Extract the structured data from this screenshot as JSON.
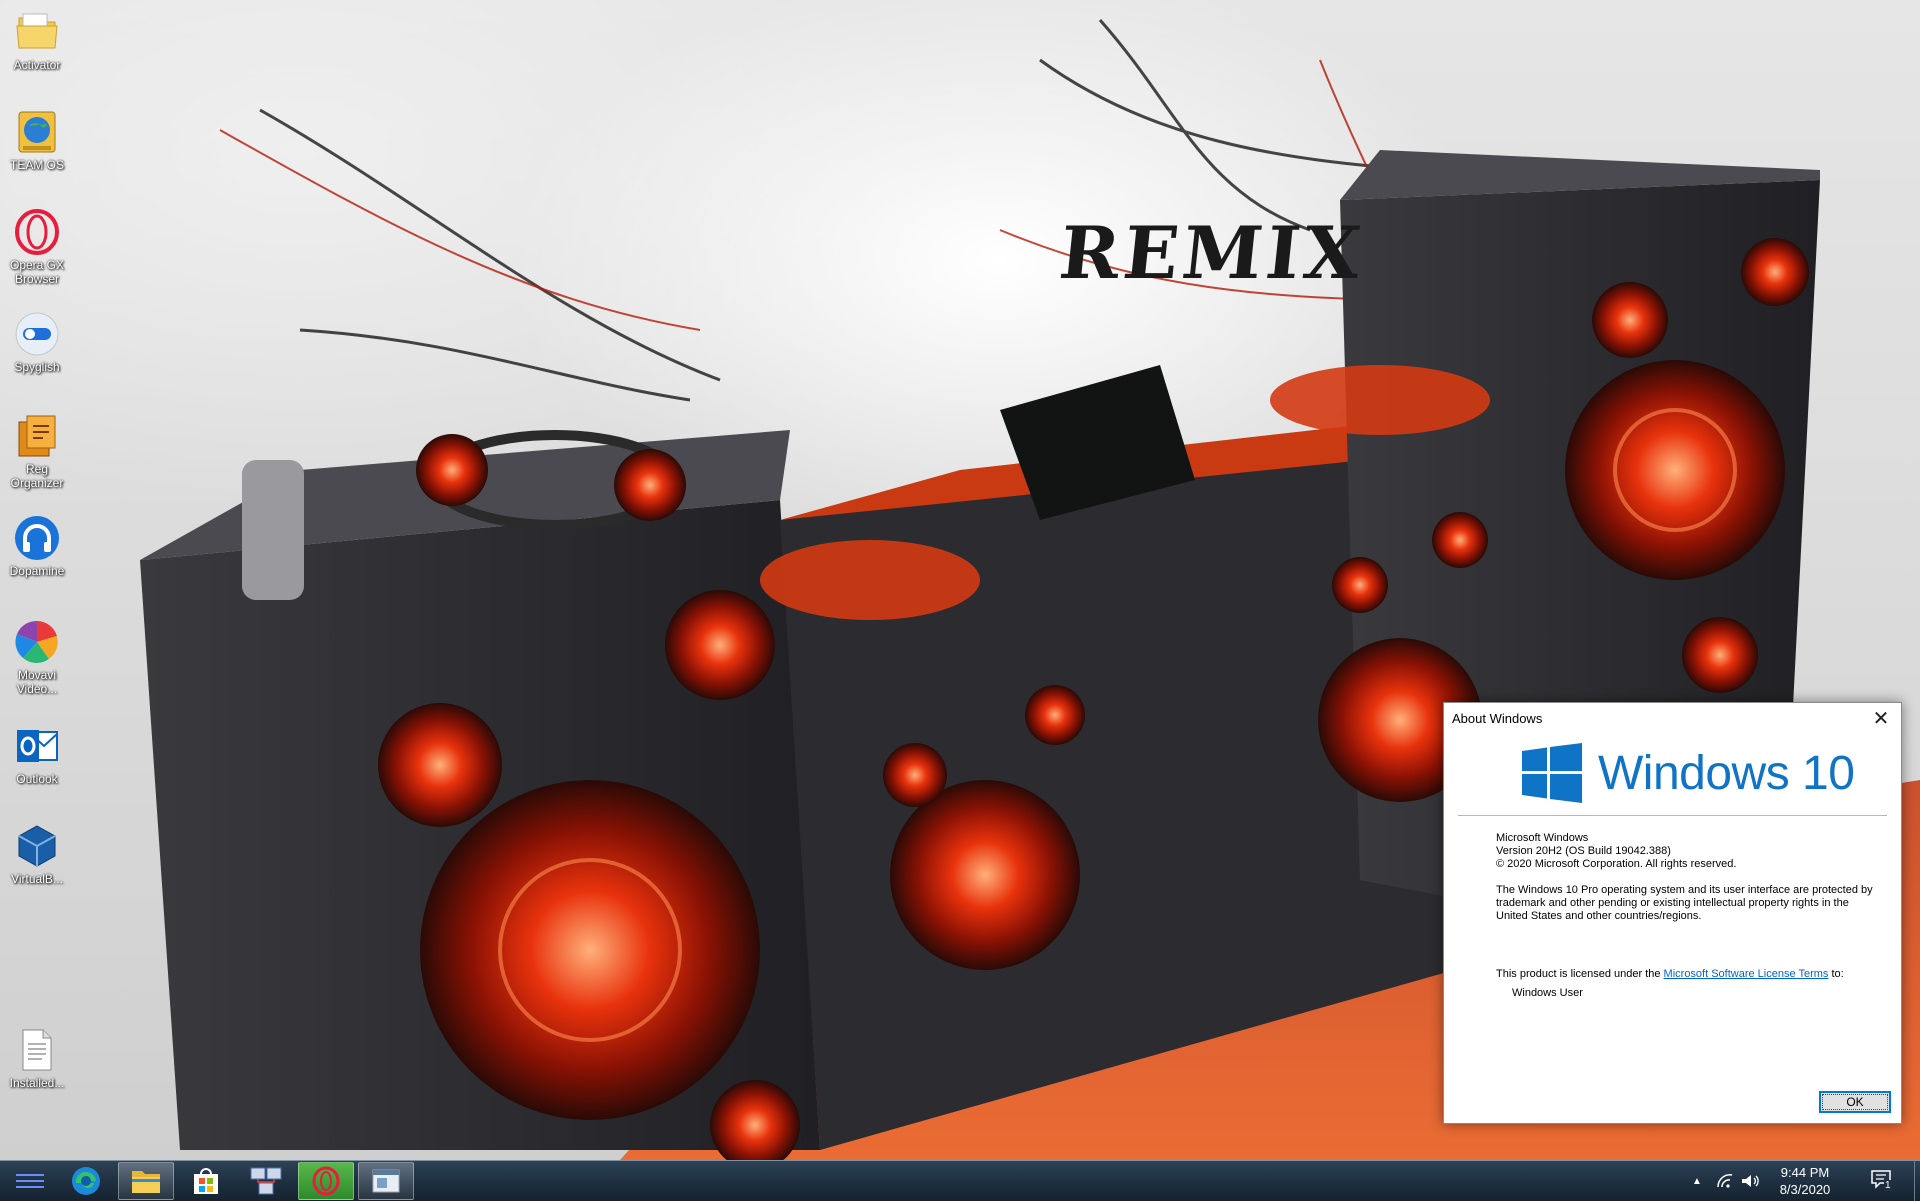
{
  "desktop": {
    "wallpaper_text": "REMIX",
    "icons": [
      {
        "label": "Activator",
        "icon": "folder-icon"
      },
      {
        "label": "TEAM OS",
        "icon": "globe-app-icon"
      },
      {
        "label": "Opera GX Browser",
        "icon": "opera-gx-icon"
      },
      {
        "label": "Spyglish",
        "icon": "toggle-app-icon"
      },
      {
        "label": "Reg Organizer",
        "icon": "reg-organizer-icon"
      },
      {
        "label": "Dopamine",
        "icon": "headphones-icon"
      },
      {
        "label": "Movavi Video...",
        "icon": "movavi-icon"
      },
      {
        "label": "Outlook",
        "icon": "outlook-icon"
      },
      {
        "label": "VirtualB...",
        "icon": "virtualbox-icon"
      },
      {
        "label": "Installed...",
        "icon": "text-file-icon"
      }
    ]
  },
  "about_dialog": {
    "title": "About Windows",
    "brand": "Windows 10",
    "product": "Microsoft Windows",
    "version": "Version 20H2 (OS Build 19042.388)",
    "copyright": "© 2020 Microsoft Corporation. All rights reserved.",
    "legal": "The Windows 10 Pro operating system and its user interface are protected by trademark and other pending or existing intellectual property rights in the United States and other countries/regions.",
    "license_prefix": "This product is licensed under the",
    "license_link": "Microsoft Software License Terms",
    "license_suffix": "to:",
    "licensed_user": "Windows User",
    "ok_label": "OK"
  },
  "taskbar": {
    "apps": [
      {
        "name": "start",
        "icon": "start-icon"
      },
      {
        "name": "edge",
        "icon": "edge-icon"
      },
      {
        "name": "file-explorer",
        "icon": "folder-icon"
      },
      {
        "name": "store",
        "icon": "store-icon"
      },
      {
        "name": "network",
        "icon": "network-icon"
      },
      {
        "name": "opera-gx",
        "icon": "opera-gx-icon",
        "active": true
      },
      {
        "name": "winver",
        "icon": "window-app-icon",
        "active": true
      }
    ],
    "time": "9:44 PM",
    "date": "8/3/2020",
    "notification_count": "1",
    "accent": "#0078d7"
  }
}
